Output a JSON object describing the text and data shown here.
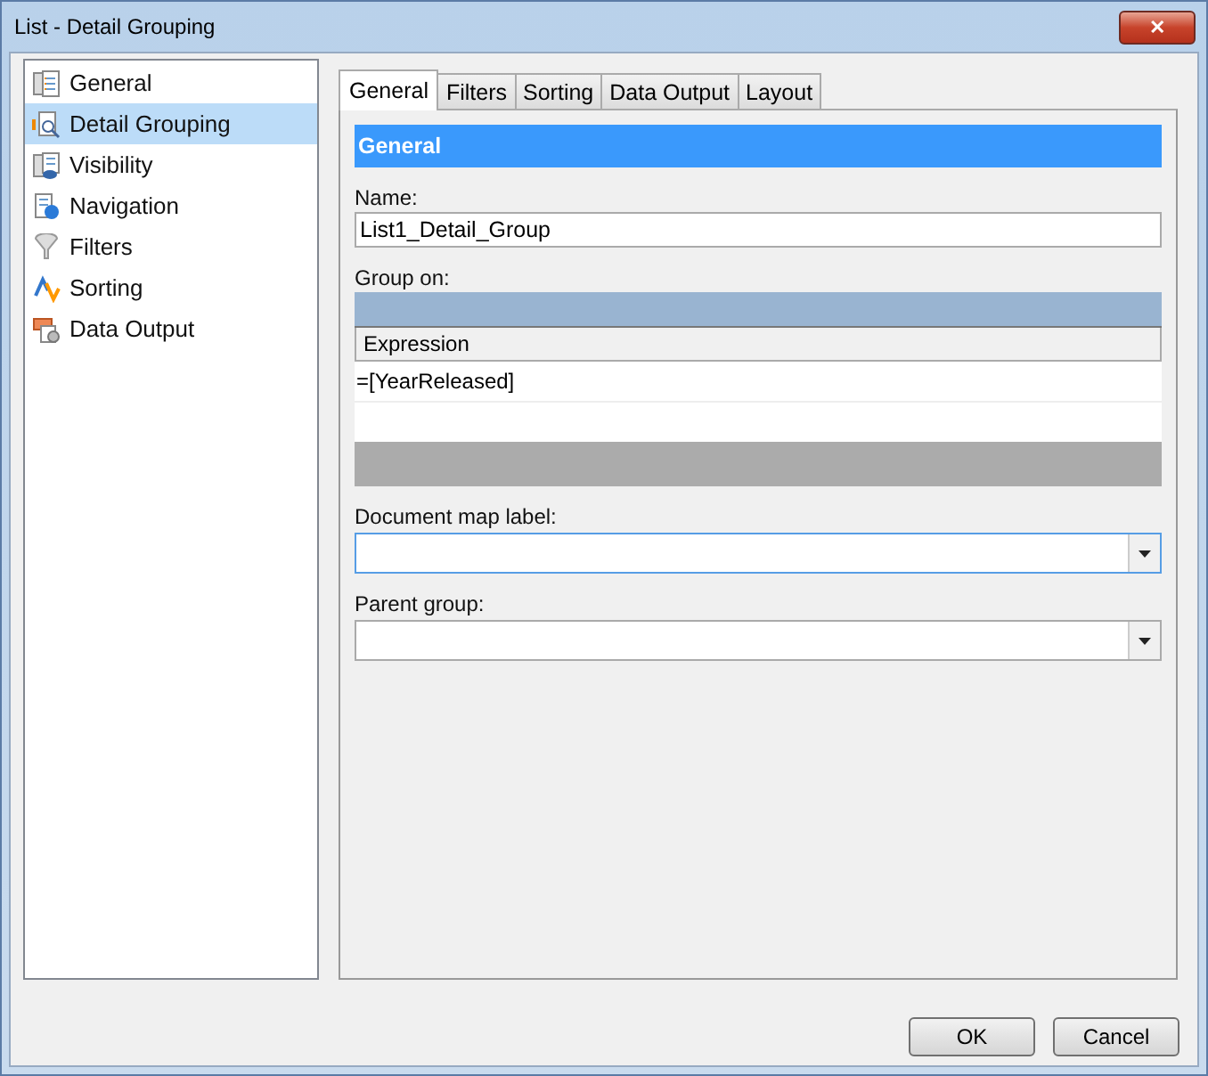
{
  "window": {
    "title": "List - Detail Grouping",
    "close_glyph": "✕"
  },
  "sidebar": {
    "items": [
      {
        "label": "General",
        "kind": "page",
        "selected": false
      },
      {
        "label": "Detail Grouping",
        "kind": "grouping",
        "selected": true
      },
      {
        "label": "Visibility",
        "kind": "visibility",
        "selected": false
      },
      {
        "label": "Navigation",
        "kind": "navigation",
        "selected": false
      },
      {
        "label": "Filters",
        "kind": "filter",
        "selected": false
      },
      {
        "label": "Sorting",
        "kind": "sort",
        "selected": false
      },
      {
        "label": "Data Output",
        "kind": "output",
        "selected": false
      }
    ]
  },
  "tabs": [
    {
      "label": "General",
      "selected": true
    },
    {
      "label": "Filters",
      "selected": false
    },
    {
      "label": "Sorting",
      "selected": false
    },
    {
      "label": "Data Output",
      "selected": false
    },
    {
      "label": "Layout",
      "selected": false
    }
  ],
  "panel": {
    "header": "General",
    "name": {
      "label": "Name:",
      "value": "List1_Detail_Group"
    },
    "group_on": {
      "label": "Group on:",
      "columns": [
        "Expression"
      ],
      "rows": [
        "=[YearReleased]"
      ]
    },
    "document_map_label": {
      "label": "Document map label:",
      "focused": true
    },
    "parent_group": {
      "label": "Parent group:",
      "focused": false
    }
  },
  "buttons": [
    "OK",
    "Cancel"
  ]
}
